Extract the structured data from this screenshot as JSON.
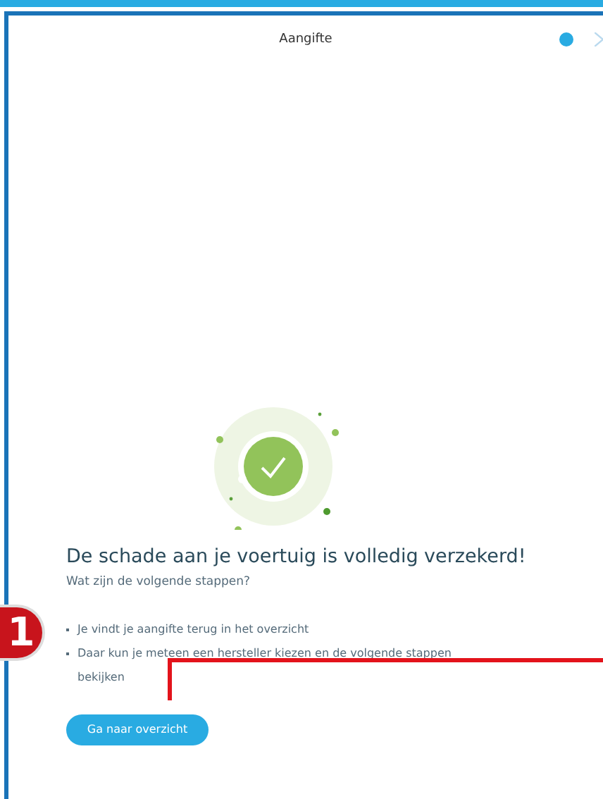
{
  "dialog": {
    "title": "Aangifte",
    "heading": "De schade aan je voertuig is volledig verzekerd!",
    "subtitle": "Wat zijn de volgende stappen?",
    "steps": [
      "Je vindt je aangifte terug in het overzicht",
      "Daar kun je meteen een hersteller kiezen en de volgende stappen bekijken"
    ],
    "button": "Ga naar overzicht"
  },
  "annotation": {
    "number": "1"
  }
}
